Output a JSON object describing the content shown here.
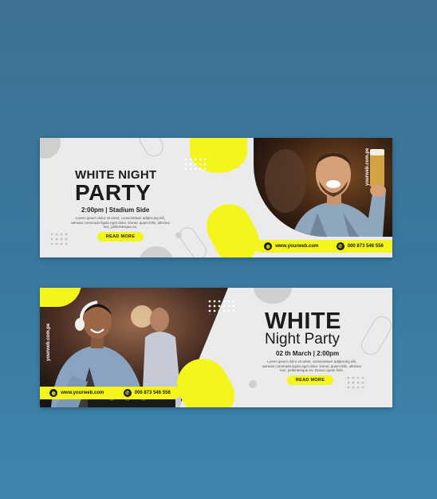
{
  "colors": {
    "accent": "#f4f51c",
    "dark": "#1b1b1b",
    "banner_bg": "#ebebeb",
    "background": "#3a789d"
  },
  "banner_top": {
    "title_line1": "WHITE NIGHT",
    "title_line2": "PARTY",
    "subtitle": "2:00pm | Stadium Side",
    "body": "Lorem ipsum dolor sit amet, consectetuer adipiscing elit, aenean commodo ligula eget dolor. Donec quam felis, ultricies nec, pellentesque eu.",
    "button_label": "READ MORE",
    "website": "www.yourweb.com",
    "phone": "000 873 546 556",
    "side_url": "yourweb.com.pe"
  },
  "banner_bottom": {
    "title_line1": "WHITE",
    "title_line2": "Night Party",
    "subtitle": "02 th March | 2:00pm",
    "body": "Lorem ipsum dolor sit amet, consectetuer adipiscing elit, aenean commodo ligula eget dolor. Donec quam felis, ultricies nec, pellentesque eu. Donec quam felis.",
    "button_label": "READ MORE",
    "website": "www.yourweb.com",
    "phone": "000 873 546 556",
    "side_url": "yourweb.com.pe"
  },
  "icons": {
    "web": "globe-icon",
    "phone": "phone-icon"
  }
}
